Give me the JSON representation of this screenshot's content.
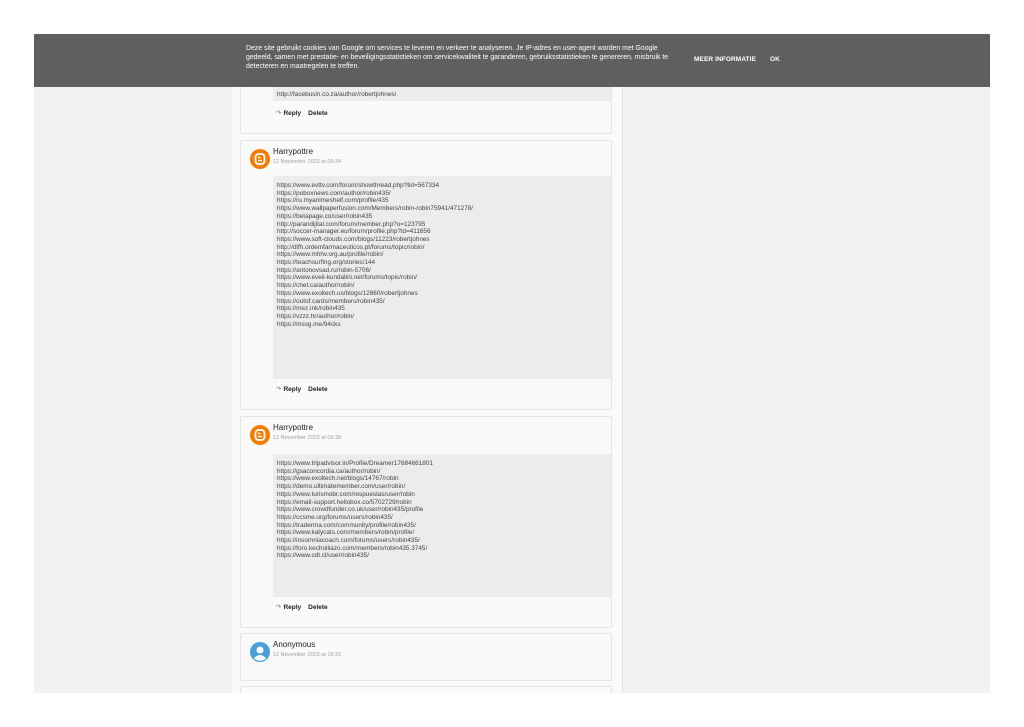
{
  "cookie": {
    "text": "Deze site gebruikt cookies van Google om services te leveren en verkeer te analyseren. Je IP-adres en user-agent worden met Google gedeeld, samen met prestatie- en beveiligingsstatistieken om servicekwaliteit te garanderen, gebruiksstatistieken te genereren, misbruik te detecteren en maatregelen te treffen.",
    "more_info": "MEER INFORMATIE",
    "ok": "OK"
  },
  "partial_comment": {
    "last_link": "http://facebusin.co.za/author/robertjohnes/",
    "reply": "Reply",
    "delete": "Delete"
  },
  "comments": [
    {
      "author": "Harrypottre",
      "date": "12 November 2022 at 09:34",
      "avatar": "blogger-icon",
      "links": [
        "https://www.evttv.com/forum/showthread.php?tid=567334",
        "https://poboxnews.com/author/robin435/",
        "https://ru.myanimeshelf.com/profile/435",
        "https://www.wallpaperfusion.com/Members/robin-robin75941/471278/",
        "https://betapage.co/user/robin435",
        "http://parandijital.com/forum/member.php?u=123795",
        "http://soccer-manager.eu/forum/profile.php?id=411656",
        "https://www.soft-clouds.com/blogs/11223/robertjohnes",
        "http://dlfh.ordemfarmaceuticos.pt/forums/topic/robin/",
        "https://www.mhhv.org.au/profile/robin/",
        "https://teachsurfing.org/stories/144",
        "https://antonovsad.ru/robin-5706/",
        "https://www.eveil-kundalini.net/forums/topic/robin/",
        "https://chet.ca/author/robin/",
        "https://www.exoltech.us/blogs/12860/robertjohnes",
        "https://outof.cards/members/robin435/",
        "https://mez.ink/robin435",
        "https://vzzz.hr/author/robin/",
        "https://mssg.me/94cks"
      ],
      "reply": "Reply",
      "delete": "Delete"
    },
    {
      "author": "Harrypottre",
      "date": "12 November 2022 at 09:38",
      "avatar": "blogger-icon",
      "links": [
        "https://www.tripadvisor.in/Profile/Dreamer17684661801",
        "https://gsaconcordia.ca/author/robin/",
        "https://www.exoltech.net/blogs/14767/robin",
        "https://demo.ultimatemember.com/user/robin/",
        "https://www.turismobr.com/respuestas/user/robin",
        "https://email-support.hellobox.co/5702729/robin",
        "https://www.crowdfunder.co.uk/user/robin435/profile",
        "https://ccsme.org/forums/users/robin435/",
        "https://traderma.com/community/profile/robin435/",
        "https://www.katycats.com/members/robin/profile/",
        "https://insomniacoach.com/forums/users/robin435/",
        "https://foro.kecholliazo.com/members/robin435.3745/",
        "https://www.cdt.cl/user/robin435/"
      ],
      "reply": "Reply",
      "delete": "Delete"
    },
    {
      "author": "Anonymous",
      "date": "12 November 2022 at 18:21",
      "avatar": "anonymous-user-icon"
    }
  ],
  "colors": {
    "blogger_orange": "#f57c00",
    "anonymous_blue": "#4a9fd8",
    "cookie_bar": "#5f5f5f"
  }
}
